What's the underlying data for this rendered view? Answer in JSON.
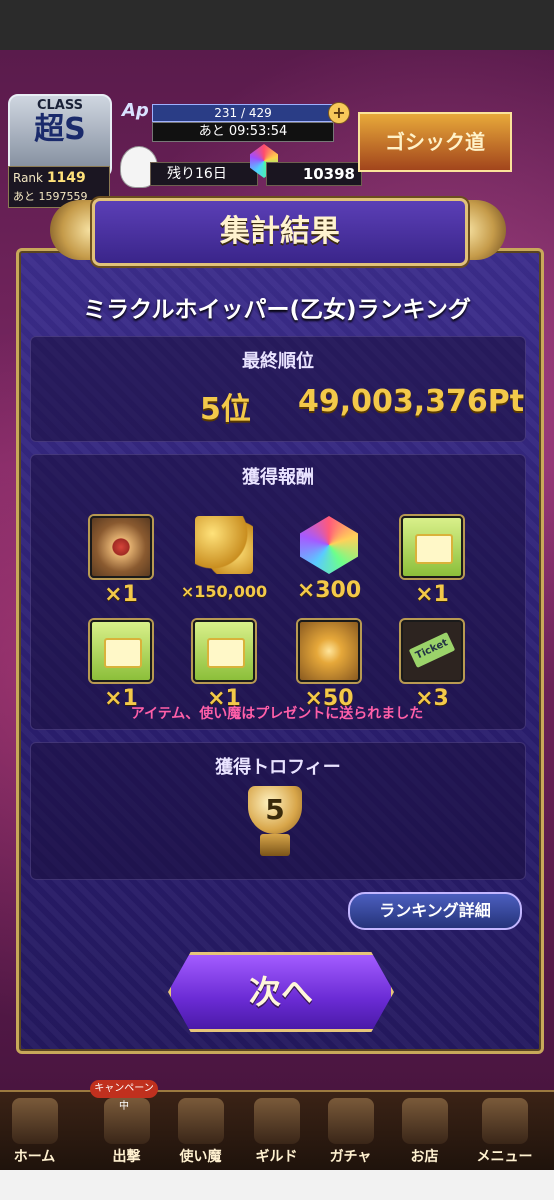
{
  "hud": {
    "class_label": "CLASS",
    "class_rank": "超S",
    "rank_label": "Rank",
    "rank_value": "1149",
    "rank_next_label": "あと",
    "rank_next_value": "1597559",
    "ap_label": "Ap",
    "ap_value": "231 / 429",
    "ap_timer": "あと 09:53:54",
    "days_left": "残り16日",
    "gem_count": "10398",
    "banner_text": "ゴシック道"
  },
  "modal": {
    "title": "集計結果",
    "ranking_name": "ミラクルホイッパー(乙女)ランキング",
    "final_rank_heading": "最終順位",
    "final_rank": "5位",
    "final_points": "49,003,376Pt",
    "rewards_heading": "獲得報酬",
    "rewards": [
      {
        "icon": "star-emblem-icon",
        "qty": "×1"
      },
      {
        "icon": "gold-coins-icon",
        "qty": "×150,000"
      },
      {
        "icon": "rainbow-gem-icon",
        "qty": "×300"
      },
      {
        "icon": "ticket-box-icon",
        "qty": "×1"
      },
      {
        "icon": "ticket-box-icon",
        "qty": "×1"
      },
      {
        "icon": "ticket-box-icon",
        "qty": "×1"
      },
      {
        "icon": "golden-feather-icon",
        "qty": "×50"
      },
      {
        "icon": "ticket-icon",
        "qty": "×3"
      }
    ],
    "rewards_notice": "アイテム、使い魔はプレゼントに送られました",
    "trophy_heading": "獲得トロフィー",
    "trophy_number": "5",
    "detail_button": "ランキング詳細",
    "next_button": "次へ"
  },
  "nav": {
    "campaign_badge": "キャンペーン中",
    "items": [
      "ホーム",
      "出撃",
      "使い魔",
      "ギルド",
      "ガチャ",
      "お店",
      "メニュー"
    ]
  }
}
